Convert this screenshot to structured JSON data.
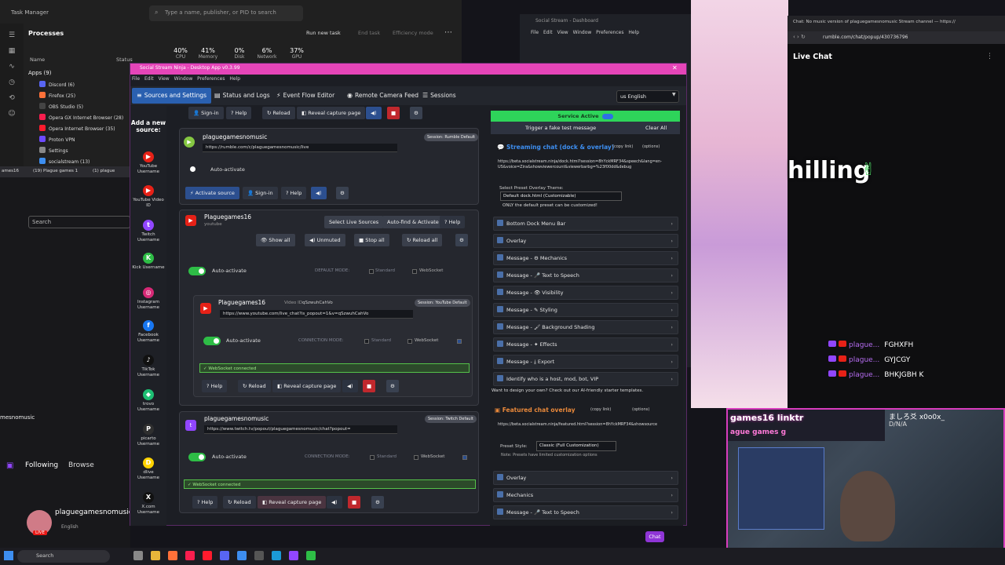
{
  "task_manager": {
    "title": "Task Manager",
    "search_placeholder": "Type a name, publisher, or PID to search",
    "heading": "Processes",
    "run_task": "Run new task",
    "end_task": "End task",
    "efficiency": "Efficiency mode",
    "columns": [
      {
        "value": "40%",
        "label": "CPU"
      },
      {
        "value": "41%",
        "label": "Memory"
      },
      {
        "value": "0%",
        "label": "Disk"
      },
      {
        "value": "6%",
        "label": "Network"
      },
      {
        "value": "37%",
        "label": "GPU"
      }
    ],
    "name_header": "Name",
    "status_header": "Status",
    "group": "Apps (9)",
    "processes": [
      "Discord (6)",
      "Firefox (25)",
      "OBS Studio (5)",
      "Opera GX Internet Browser (28)",
      "Opera Internet Browser (35)",
      "Proton VPN",
      "Settings",
      "socialstream (13)"
    ]
  },
  "twitch_left": {
    "tabs": [
      "ames16",
      "(19) Plague games 1",
      "(1) plague"
    ],
    "search": "Search",
    "sub_name": "mesnomusic",
    "following": "Following",
    "browse": "Browse",
    "channel": "plaguegamesnomusic",
    "language": "English",
    "live": "LIVE"
  },
  "bg_dashboard": {
    "title": "Social Stream - Dashboard",
    "menu": "File Edit View Window Preferences Help"
  },
  "app": {
    "title": "Social Stream Ninja - Desktop App v0.3.99",
    "menu": "File Edit View Window Preferences Help",
    "tabs": [
      {
        "label": "Sources and Settings",
        "icon": "≡"
      },
      {
        "label": "Status and Logs",
        "icon": "▤"
      },
      {
        "label": "Event Flow Editor",
        "icon": "⚡"
      },
      {
        "label": "Remote Camera Feed",
        "icon": "◉"
      },
      {
        "label": "Sessions",
        "icon": "☰"
      }
    ],
    "language": "us English",
    "add_source_title": "Add a new source:",
    "sources": [
      {
        "label": "YouTube Username",
        "color": "#e62117",
        "glyph": "▶"
      },
      {
        "label": "YouTube Video ID",
        "color": "#e62117",
        "glyph": "▶"
      },
      {
        "label": "Twitch Username",
        "color": "#9146ff",
        "glyph": "t"
      },
      {
        "label": "Kick Username",
        "color": "#2ebd46",
        "glyph": "K"
      },
      {
        "label": "Instagram Username",
        "color": "#d62976",
        "glyph": "◎"
      },
      {
        "label": "Facebook Username",
        "color": "#1877f2",
        "glyph": "f"
      },
      {
        "label": "TikTok Username",
        "color": "#111111",
        "glyph": "♪"
      },
      {
        "label": "trovo Username",
        "color": "#1dbf73",
        "glyph": "◆"
      },
      {
        "label": "picarto Username",
        "color": "#2f2f2f",
        "glyph": "P"
      },
      {
        "label": "dlive Username",
        "color": "#ffd300",
        "glyph": "D"
      },
      {
        "label": "X.com Username",
        "color": "#111111",
        "glyph": "X"
      }
    ],
    "top_row": {
      "signin": "Sign-in",
      "help": "Help",
      "reload": "Reload",
      "reveal": "Reveal capture page"
    },
    "rumble": {
      "name": "plaguegamesnomusic",
      "session": "Session: Rumble Default",
      "url": "https://rumble.com/c/plaguegamesnomusic/live",
      "auto": "Auto-activate",
      "activate": "Activate source",
      "signin": "Sign-in",
      "help": "Help"
    },
    "youtube": {
      "name": "Plaguegames16",
      "platform": "youtube",
      "select_live": "Select Live Sources",
      "autofind": "Auto-find & Activate",
      "help": "Help",
      "show_all": "Show all",
      "unmuted": "Unmuted",
      "stop_all": "Stop all",
      "reload_all": "Reload all",
      "auto": "Auto-activate",
      "default_mode": "DEFAULT MODE:",
      "standard": "Standard",
      "websocket": "WebSocket",
      "inner": {
        "name": "Plaguegames16",
        "video_id_label": "Video ID",
        "video_id": "qSzwuhCahVo",
        "session": "Session: YouTube Default",
        "url": "https://www.youtube.com/live_chat?is_popout=1&v=qSzwuhCahVo",
        "auto": "Auto-activate",
        "conn_mode": "CONNECTION MODE:",
        "standard": "Standard",
        "websocket": "WebSocket",
        "ws_connected": "WebSocket connected",
        "help": "Help",
        "reload": "Reload",
        "reveal": "Reveal capture page"
      }
    },
    "twitch": {
      "name": "plaguegamesnomusic",
      "session": "Session: Twitch Default",
      "url": "https://www.twitch.tv/popout/plaguegamesnomusic/chat?popout=",
      "auto": "Auto-activate",
      "conn_mode": "CONNECTION MODE:",
      "standard": "Standard",
      "websocket": "WebSocket",
      "ws_connected": "WebSocket connected",
      "help": "Help",
      "reload": "Reload",
      "reveal": "Reveal capture page"
    },
    "right": {
      "service": "Service Active",
      "fake": "Trigger a fake test message",
      "clear": "Clear All",
      "stream_head": "Streaming chat (dock & overlay)",
      "copy_link": "(copy link)",
      "options": "(options)",
      "dock_url": "https://beta.socialstream.ninja/dock.html?session=8hYckMRF34&speech&lang=en-US&voice=Zira&showviewercount&viewerbarbg=%23f00dd&debug",
      "theme_label": "Select Preset Overlay Theme:",
      "theme": "Default dock.html (Customizable)",
      "theme_note": "ONLY the default preset can be customized!",
      "accordions": [
        "Bottom Dock Menu Bar",
        "Overlay",
        "Message - ⚙ Mechanics",
        "Message - 🎤 Text to Speech",
        "Message - 👁 Visibility",
        "Message - ✎ Styling",
        "Message - 🖌 Background Shading",
        "Message - ✦ Effects",
        "Message - ⤓ Export",
        "Identify who is a host, mod, bot, VIP"
      ],
      "shade_note": "Want to design your own? Check out our AI-friendly starter templates.",
      "feat_head": "Featured chat overlay",
      "feat_url": "https://beta.socialstream.ninja/featured.html?session=8hYckMRF34&showsource",
      "preset_label": "Preset Style:",
      "preset": "Classic (Full Customization)",
      "preset_note": "Note: Presets have limited customization options",
      "accordions2": [
        "Overlay",
        "Mechanics",
        "Message - 🎤 Text to Speech"
      ]
    },
    "chat_btn": "Chat"
  },
  "browser": {
    "tab": "Chat: No music version of plaguegamesnomusic Stream channel — https://",
    "url": "rumble.com/chat/popup/430736796",
    "live_chat": "Live Chat",
    "overlay_text": "hilling",
    "messages": [
      {
        "user": "plague...",
        "text": "FGHXFH"
      },
      {
        "user": "plague...",
        "text": "GYJCGY"
      },
      {
        "user": "plague...",
        "text": "BHKJGBH K"
      }
    ]
  },
  "webcam": {
    "name": "games16 linktr",
    "sub": "ague games g",
    "jp": "ましろ爻 x0o0x_",
    "na": "D/N/A"
  },
  "taskbar": {
    "search": "Search"
  },
  "colors": {
    "accent": "#e545b8",
    "active_tab": "#2a60b0",
    "service": "#2ed45a"
  }
}
